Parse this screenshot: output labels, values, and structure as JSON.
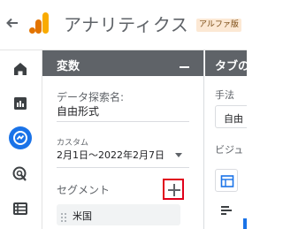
{
  "header": {
    "title": "アナリティクス",
    "badge": "アルファ版",
    "back_icon": "arrow-back-icon",
    "logo_icon": "analytics-logo-icon"
  },
  "nav": {
    "items": [
      {
        "icon": "home-icon"
      },
      {
        "icon": "reports-icon"
      },
      {
        "icon": "explore-icon",
        "active": true
      },
      {
        "icon": "advertising-icon"
      },
      {
        "icon": "configure-icon"
      }
    ]
  },
  "variables": {
    "title": "変数",
    "exploration_name_label": "データ探索名:",
    "exploration_name_value": "自由形式",
    "date_caption": "カスタム",
    "date_range": "2月1日～2022年2月7日",
    "segment_label": "セグメント",
    "segment_chip": "米国"
  },
  "tab_settings": {
    "title": "タブの",
    "technique_label": "手法",
    "technique_value": "自由",
    "viz_label": "ビジュ"
  },
  "colors": {
    "panel_header": "#5f6368",
    "accent": "#1a73e8",
    "highlight_box": "#e0001b",
    "badge_bg": "#fce8d4",
    "logo_orange": "#f9ab00",
    "logo_dark": "#e37400"
  }
}
